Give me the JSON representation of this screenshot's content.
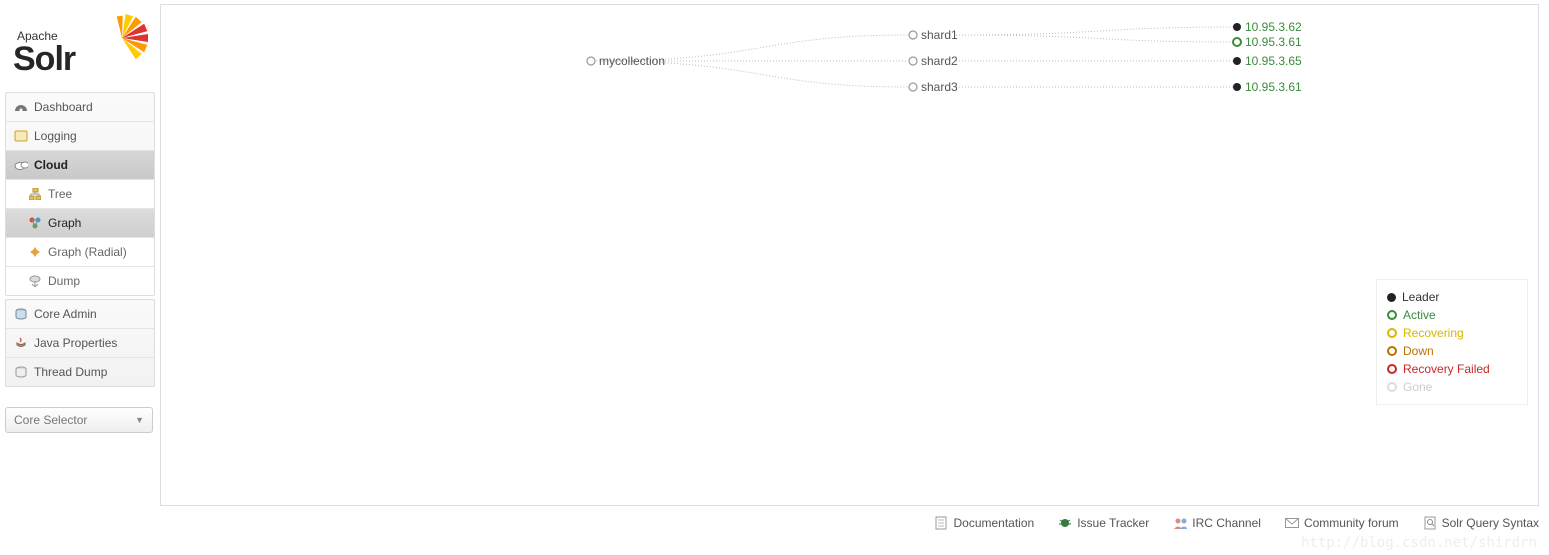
{
  "logo": {
    "apache": "Apache",
    "solr": "Solr"
  },
  "sidebar": {
    "dashboard": "Dashboard",
    "logging": "Logging",
    "cloud": "Cloud",
    "cloud_items": {
      "tree": "Tree",
      "graph": "Graph",
      "radial": "Graph (Radial)",
      "dump": "Dump"
    },
    "core_admin": "Core Admin",
    "java_props": "Java Properties",
    "thread_dump": "Thread Dump",
    "core_selector": "Core Selector"
  },
  "graph": {
    "collection": "mycollection",
    "shards": [
      "shard1",
      "shard2",
      "shard3"
    ],
    "replicas": [
      {
        "shard": 0,
        "ip": "10.95.3.62",
        "leader": true
      },
      {
        "shard": 0,
        "ip": "10.95.3.61",
        "leader": false
      },
      {
        "shard": 1,
        "ip": "10.95.3.65",
        "leader": true
      },
      {
        "shard": 2,
        "ip": "10.95.3.61",
        "leader": true
      }
    ]
  },
  "legend": {
    "leader": "Leader",
    "active": "Active",
    "recovering": "Recovering",
    "down": "Down",
    "recovery_failed": "Recovery Failed",
    "gone": "Gone"
  },
  "footer": {
    "doc": "Documentation",
    "issue": "Issue Tracker",
    "irc": "IRC Channel",
    "forum": "Community forum",
    "query": "Solr Query Syntax"
  },
  "watermark": "http://blog.csdn.net/shirdrn"
}
